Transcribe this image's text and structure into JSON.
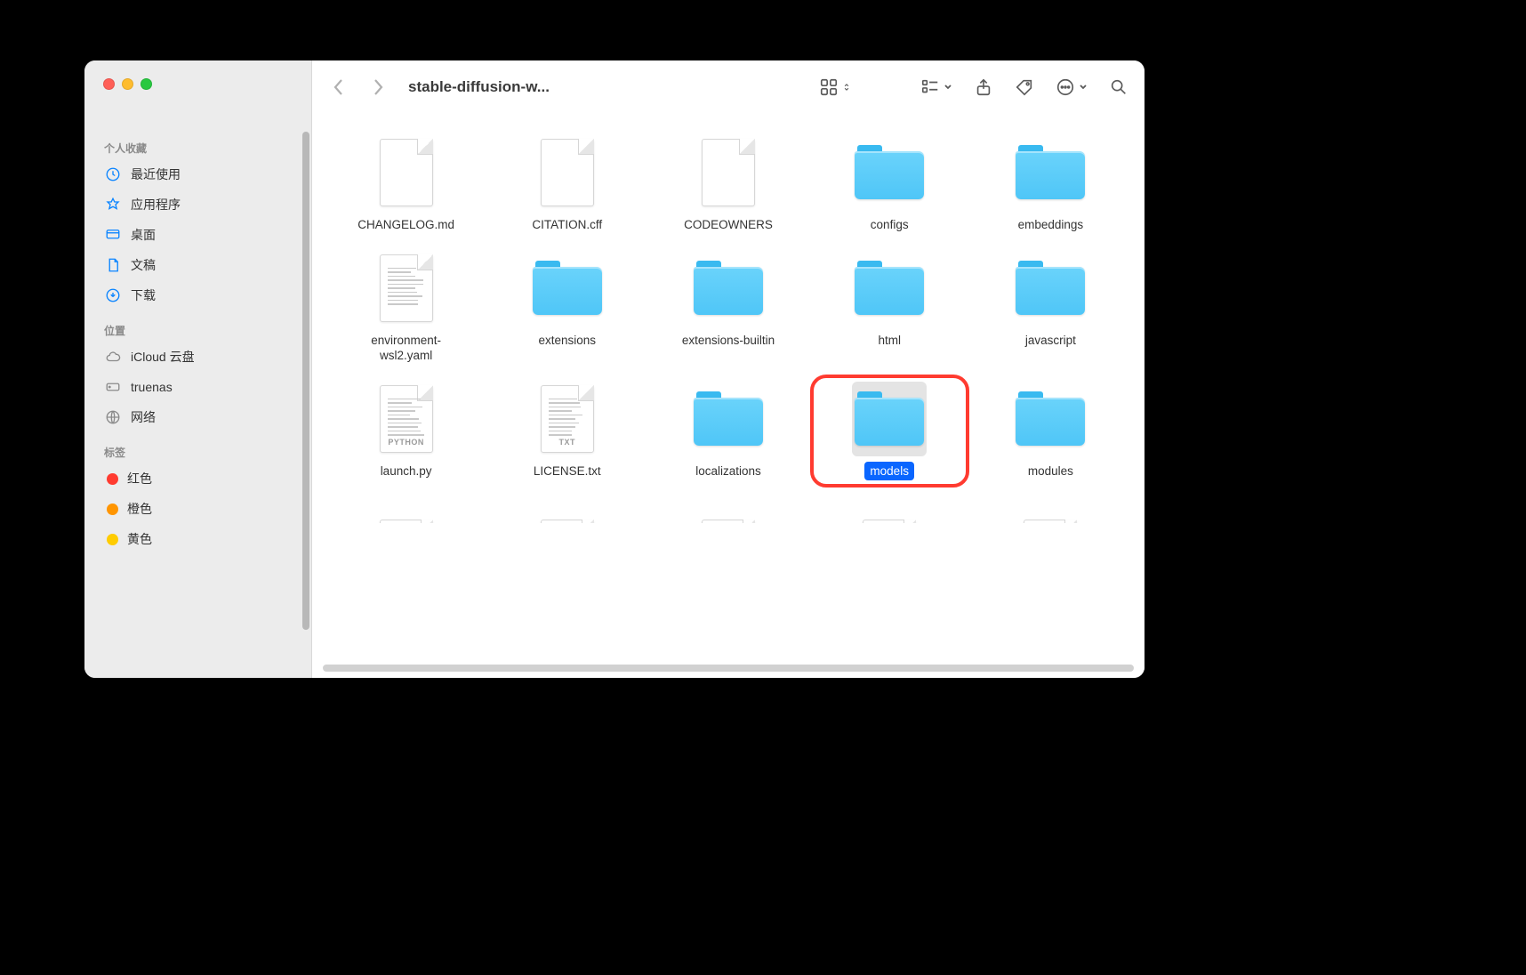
{
  "window": {
    "title": "stable-diffusion-w..."
  },
  "sidebar": {
    "sections": [
      {
        "header": "个人收藏",
        "items": [
          {
            "icon": "clock",
            "label": "最近使用"
          },
          {
            "icon": "apps",
            "label": "应用程序"
          },
          {
            "icon": "desktop",
            "label": "桌面"
          },
          {
            "icon": "doc",
            "label": "文稿"
          },
          {
            "icon": "download",
            "label": "下载"
          }
        ]
      },
      {
        "header": "位置",
        "items": [
          {
            "icon": "cloud",
            "label": "iCloud 云盘"
          },
          {
            "icon": "server",
            "label": "truenas"
          },
          {
            "icon": "network",
            "label": "网络"
          }
        ]
      },
      {
        "header": "标签",
        "items": [
          {
            "color": "#ff3b30",
            "label": "红色"
          },
          {
            "color": "#ff9500",
            "label": "橙色"
          },
          {
            "color": "#ffcc00",
            "label": "黄色"
          }
        ]
      }
    ]
  },
  "files": {
    "rows": [
      [
        {
          "type": "file",
          "label": "CHANGELOG.md"
        },
        {
          "type": "file",
          "label": "CITATION.cff"
        },
        {
          "type": "file",
          "label": "CODEOWNERS"
        },
        {
          "type": "folder",
          "label": "configs"
        },
        {
          "type": "folder",
          "label": "embeddings"
        }
      ],
      [
        {
          "type": "file",
          "label": "environment-\nwsl2.yaml",
          "lines": true
        },
        {
          "type": "folder",
          "label": "extensions"
        },
        {
          "type": "folder",
          "label": "extensions-builtin"
        },
        {
          "type": "folder",
          "label": "html"
        },
        {
          "type": "folder",
          "label": "javascript"
        }
      ],
      [
        {
          "type": "file",
          "label": "launch.py",
          "badge": "PYTHON",
          "lines": true
        },
        {
          "type": "file",
          "label": "LICENSE.txt",
          "badge": "TXT",
          "lines": true
        },
        {
          "type": "folder",
          "label": "localizations"
        },
        {
          "type": "folder",
          "label": "models",
          "selected": true,
          "highlighted": true
        },
        {
          "type": "folder",
          "label": "modules"
        }
      ]
    ],
    "partial_row": [
      {
        "type": "file"
      },
      {
        "type": "file"
      },
      {
        "type": "file"
      },
      {
        "type": "file"
      },
      {
        "type": "file"
      }
    ]
  }
}
